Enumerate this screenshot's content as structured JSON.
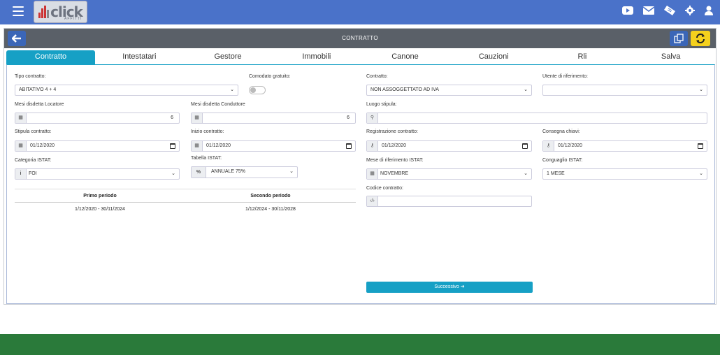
{
  "brand": {
    "logo_text": "click",
    "logo_sub": "AFFITTI"
  },
  "header": {
    "title": "CONTRATTO"
  },
  "tabs": [
    "Contratto",
    "Intestatari",
    "Gestore",
    "Immobili",
    "Canone",
    "Cauzioni",
    "Rli",
    "Salva"
  ],
  "form": {
    "tipo_contratto": {
      "label": "Tipo contratto:",
      "value": "ABITATIVO 4 + 4"
    },
    "comodato": {
      "label": "Comodato gratuito:"
    },
    "contratto": {
      "label": "Contratto:",
      "value": "NON ASSOGGETTATO AD IVA"
    },
    "utente": {
      "label": "Utente di riferimento:",
      "value": ""
    },
    "mesi_locatore": {
      "label": "Mesi disdetta Locatore",
      "value": "6"
    },
    "mesi_conduttore": {
      "label": "Mesi disdetta Conduttore",
      "value": "6"
    },
    "luogo": {
      "label": "Luogo stipula:",
      "value": ""
    },
    "stipula": {
      "label": "Stipula contratto:",
      "value": "01/12/2020"
    },
    "inizio": {
      "label": "Inizio contratto:",
      "value": "01/12/2020"
    },
    "registrazione": {
      "label": "Registrazione contratto:",
      "value": "01/12/2020"
    },
    "consegna": {
      "label": "Consegna chiavi:",
      "value": "01/12/2020"
    },
    "categoria": {
      "label": "Categoria ISTAT:",
      "value": "FOI"
    },
    "tabella": {
      "label": "Tabella ISTAT:",
      "value": "ANNUALE 75%"
    },
    "mese_rif": {
      "label": "Mese di riferimento ISTAT:",
      "value": "NOVEMBRE"
    },
    "conguaglio": {
      "label": "Conguaglio ISTAT:",
      "value": "1 MESE"
    },
    "codice": {
      "label": "Codice contratto:",
      "value": ""
    }
  },
  "periods": {
    "headers": [
      "Primo periodo",
      "Secondo periodo"
    ],
    "values": [
      "1/12/2020 - 30/11/2024",
      "1/12/2024 - 30/11/2028"
    ]
  },
  "next_button": "Successivo"
}
